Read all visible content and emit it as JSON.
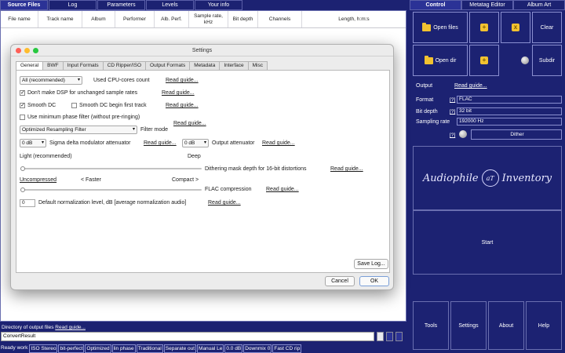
{
  "left_tabs": [
    "Source Files",
    "Log",
    "Parameters",
    "Levels",
    "Your info"
  ],
  "table_headers": [
    "File name",
    "Track name",
    "Album",
    "Performer",
    "Alb. Perf.",
    "Sample rate, kHz",
    "Bit depth",
    "Channels",
    "Length, h:m:s"
  ],
  "outdir": {
    "label": "Directory of output files",
    "link": "Read guide...",
    "value": "ConvertResult"
  },
  "status_items": [
    "Ready work",
    "ISO Stereo",
    "bit-perfect",
    "Optimized",
    "lin phase",
    "Traditional",
    "Separate out",
    "Manual Le",
    "0.0 dB",
    "Downmix 0",
    "Fast CD rip"
  ],
  "right_tabs": [
    "Control",
    "Metatag Editor",
    "Album Art"
  ],
  "control_buttons": {
    "open_files": "Open files",
    "clear": "Clear",
    "open_dir": "Open dir",
    "subdir": "Subdir",
    "add_symbol": "+",
    "remove_symbol": "x",
    "merge_symbol": "+"
  },
  "output": {
    "label": "Output",
    "link": "Read guide...",
    "format_label": "Format",
    "format_value": "FLAC",
    "bitdepth_label": "Bit depth",
    "bitdepth_value": "32 bit",
    "samplerate_label": "Sampling rate",
    "samplerate_value": "192000 Hz",
    "q": "[?]",
    "dither": "Dither"
  },
  "logo": {
    "left": "Audiophile",
    "seal": "aT",
    "right": "Inventory"
  },
  "start_label": "Start",
  "bottom_buttons": [
    "Tools",
    "Settings",
    "About",
    "Help"
  ],
  "dialog": {
    "title": "Settings",
    "tabs": [
      "General",
      "BWF",
      "Input Formats",
      "CD Ripper/ISO",
      "Output Formats",
      "Metadata",
      "Interface",
      "Misc"
    ],
    "cpu_select": "All (recommended)",
    "cpu_label": "Used CPU-cores count",
    "guide": "Read guide...",
    "no_dsp_label": "Don't make DSP for unchanged sample rates",
    "smooth_dc_label": "Smooth DC",
    "smooth_dc_begin_label": "Smooth DC begin first track",
    "min_phase_label": "Use minimum phase filter (without pre-ringing)",
    "filter_select": "Optimized Resampling Filter",
    "filter_label": "Filter mode",
    "sd_select": "0 dB",
    "sd_label": "Sigma delta modulator attenuator",
    "out_att_select": "0 dB",
    "out_att_label": "Output attenuator",
    "dither_light": "Light (recommended)",
    "dither_deep": "Deep",
    "dither_label": "Dithering mask depth for 16-bit distortions",
    "dither_level": 0,
    "flac_uncompressed": "Uncompressed",
    "flac_faster": "< Faster",
    "flac_compact": "Compact >",
    "flac_label": "FLAC compression",
    "flac_level": 0,
    "norm_value": "0",
    "norm_label": "Default normalization level, dB [average normalization audio]",
    "save_log": "Save Log...",
    "cancel": "Cancel",
    "ok": "OK"
  }
}
